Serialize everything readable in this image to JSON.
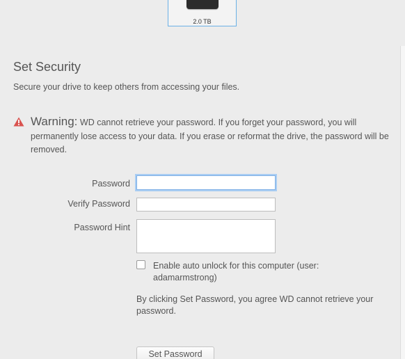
{
  "drive": {
    "size_label": "2.0 TB"
  },
  "section": {
    "title": "Set Security",
    "subtitle": "Secure your drive to keep others from accessing your files."
  },
  "warning": {
    "heading": "Warning:",
    "text": "WD cannot retrieve your password. If you forget your password, you will permanently lose access to your data. If you erase or reformat the drive, the password will be removed.",
    "icon": "warning-triangle-icon",
    "icon_color": "#d9534f"
  },
  "form": {
    "password_label": "Password",
    "password_value": "",
    "verify_label": "Verify Password",
    "verify_value": "",
    "hint_label": "Password Hint",
    "hint_value": "",
    "auto_unlock_label": "Enable auto unlock for this computer (user: adamarmstrong)",
    "auto_unlock_checked": false,
    "agreement_text": "By clicking Set Password, you agree WD cannot retrieve your password.",
    "submit_label": "Set Password"
  },
  "colors": {
    "focus_ring": "#a9cdf3",
    "selected_tile_border": "#6ab0e6"
  }
}
